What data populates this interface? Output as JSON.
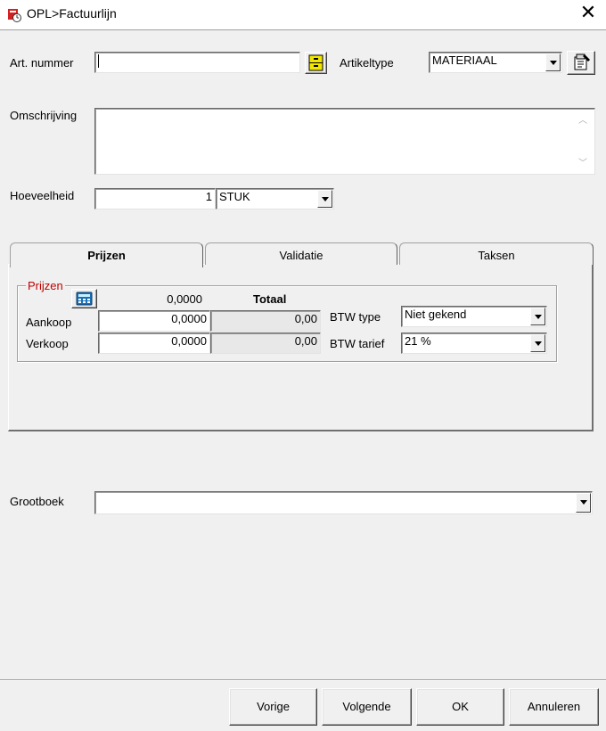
{
  "window": {
    "title": "OPL>Factuurlijn",
    "close_glyph": "✕"
  },
  "form": {
    "art_nummer_label": "Art. nummer",
    "art_nummer_value": "",
    "artikeltype_label": "Artikeltype",
    "artikeltype_value": "MATERIAAL",
    "omschrijving_label": "Omschrijving",
    "omschrijving_value": "",
    "hoeveelheid_label": "Hoeveelheid",
    "hoeveelheid_value": "1",
    "eenheid_value": "STUK",
    "grootboek_label": "Grootboek",
    "grootboek_value": ""
  },
  "tabs": [
    {
      "label": "Prijzen",
      "active": true
    },
    {
      "label": "Validatie",
      "active": false
    },
    {
      "label": "Taksen",
      "active": false
    }
  ],
  "prijzen": {
    "group_title": "Prijzen",
    "header_value": "0,0000",
    "totaal_header": "Totaal",
    "aankoop_label": "Aankoop",
    "aankoop_value": "0,0000",
    "aankoop_totaal": "0,00",
    "verkoop_label": "Verkoop",
    "verkoop_value": "0,0000",
    "verkoop_totaal": "0,00",
    "btw_type_label": "BTW type",
    "btw_type_value": "Niet gekend",
    "btw_tarief_label": "BTW tarief",
    "btw_tarief_value": "21 %"
  },
  "buttons": {
    "vorige": "Vorige",
    "volgende": "Volgende",
    "ok": "OK",
    "annuleren": "Annuleren"
  },
  "colors": {
    "group_title": "#c00000",
    "dialog_bg": "#f0f0f0",
    "calc_icon": "#1a6fb5"
  }
}
